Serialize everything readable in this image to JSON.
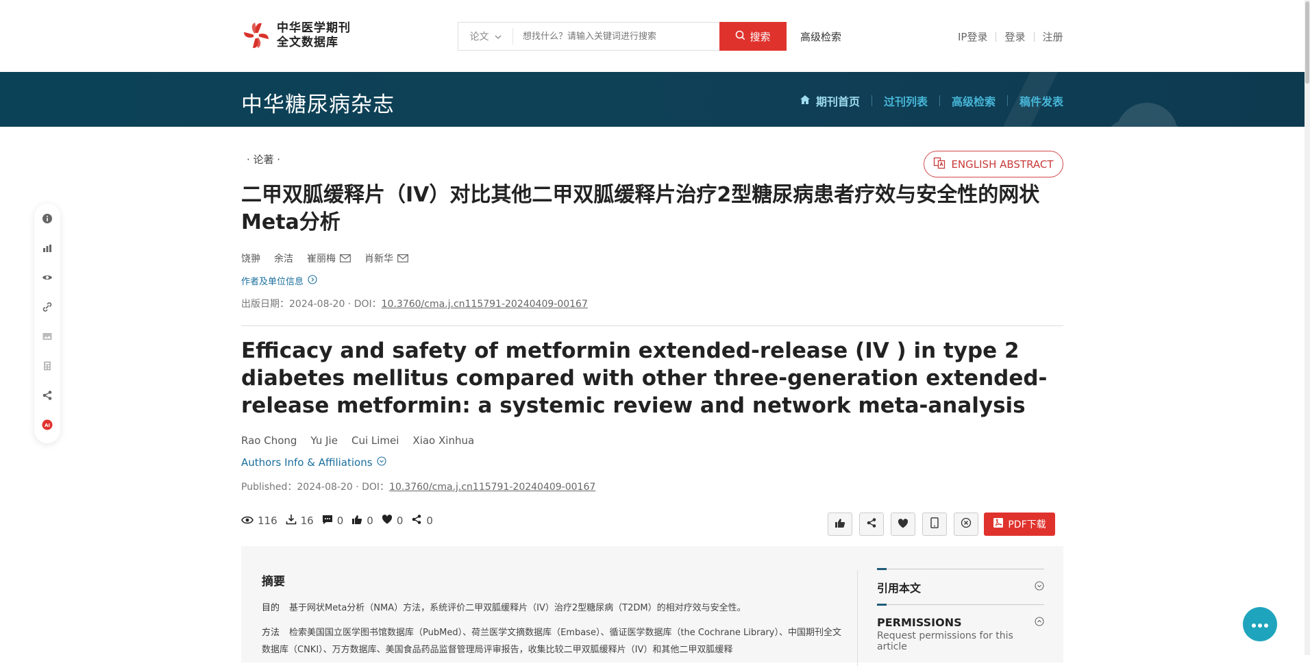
{
  "header": {
    "logo_line1": "中华医学期刊",
    "logo_line2": "全文数据库",
    "search_type": "论文",
    "search_placeholder": "想找什么？请输入关键词进行搜索",
    "search_button": "搜索",
    "advanced_search": "高级检索",
    "ip_login": "IP登录",
    "login": "登录",
    "register": "注册"
  },
  "journal": {
    "title": "中华糖尿病杂志",
    "nav": [
      "期刊首页",
      "过刊列表",
      "高级检索",
      "稿件发表"
    ]
  },
  "article": {
    "category": "·  论著  ·",
    "english_abstract_btn": "ENGLISH ABSTRACT",
    "cn_title": "二甲双胍缓释片（IV）对比其他二甲双胍缓释片治疗2型糖尿病患者疗效与安全性的网状Meta分析",
    "cn_authors": [
      "饶翀",
      "余洁",
      "崔丽梅",
      "肖新华"
    ],
    "cn_aff_link": "作者及单位信息",
    "cn_pubdate_label": "出版日期：2024-08-20 · DOI：",
    "doi": "10.3760/cma.j.cn115791-20240409-00167",
    "en_title": "Efficacy and safety of metformin extended-release (IV ) in type 2 diabetes mellitus compared with other three-generation extended-release metformin: a systemic review and network meta-analysis",
    "en_authors": [
      "Rao Chong",
      "Yu Jie",
      "Cui Limei",
      "Xiao Xinhua"
    ],
    "en_aff_link": "Authors Info & Affiliations",
    "en_pubdate_label": "Published：2024-08-20 · DOI："
  },
  "stats": {
    "views": "116",
    "downloads": "16",
    "comments": "0",
    "likes": "0",
    "favorites": "0",
    "shares": "0"
  },
  "actions": {
    "pdf": "PDF下载"
  },
  "abstract": {
    "heading": "摘要",
    "objective_label": "目的",
    "objective": "基于网状Meta分析（NMA）方法，系统评价二甲双胍缓释片（IV）治疗2型糖尿病（T2DM）的相对疗效与安全性。",
    "methods_label": "方法",
    "methods": "检索美国国立医学图书馆数据库（PubMed）、荷兰医学文摘数据库（Embase）、循证医学数据库（the Cochrane Library）、中国期刊全文数据库（CNKI）、万方数据库、美国食品药品监督管理局评审报告，收集比较二甲双胍缓释片（IV）和其他二甲双胍缓释"
  },
  "cite_panel": {
    "cite_title": "引用本文",
    "permissions_title": "PERMISSIONS",
    "permissions_sub": "Request permissions for this article"
  },
  "colors": {
    "brand_red": "#e0322d",
    "banner_bg": "#0c4257",
    "nav_text": "#47b6d8",
    "link": "#1a6e9c",
    "chat_fab": "#1fa4bd"
  }
}
